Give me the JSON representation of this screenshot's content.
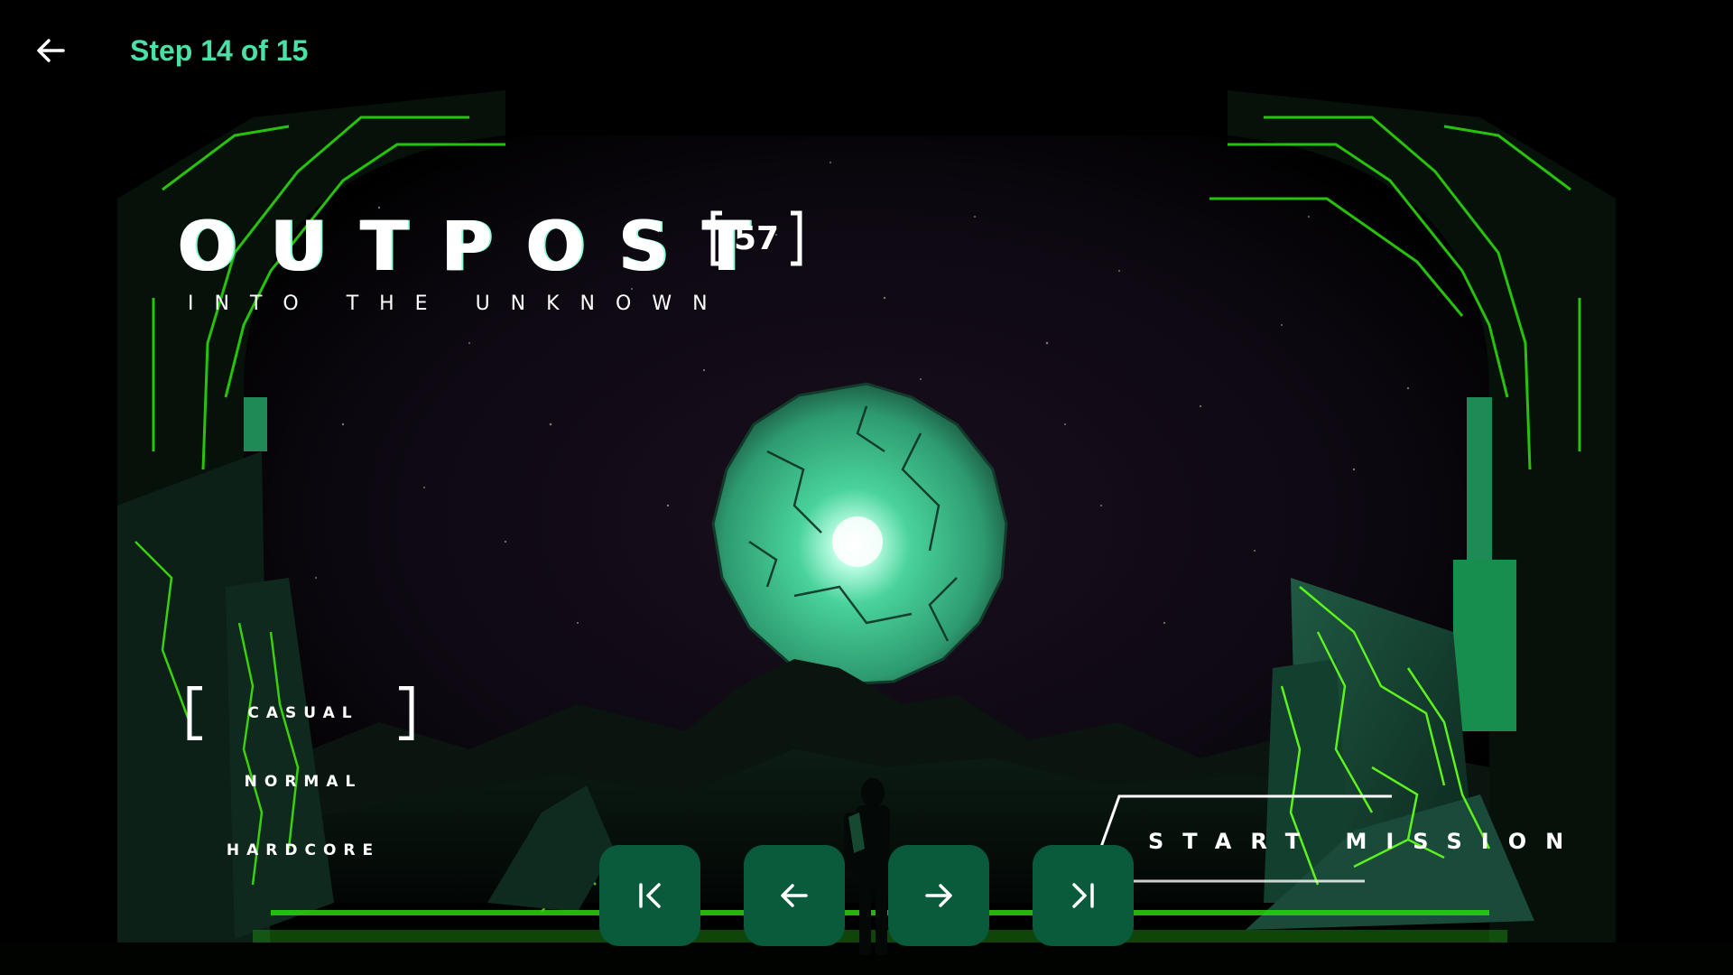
{
  "header": {
    "back_icon": "arrow-left-icon",
    "step_text": "Step 14 of 15"
  },
  "game": {
    "title": "OUTPOST",
    "badge": "57",
    "subtitle": "INTO THE UNKNOWN"
  },
  "difficulty": {
    "options": [
      "CASUAL",
      "NORMAL",
      "HARDCORE"
    ],
    "selected": "CASUAL"
  },
  "start_button": {
    "label": "START MISSION"
  },
  "navigation": {
    "first_icon": "skip-first-icon",
    "prev_icon": "arrow-left-icon",
    "next_icon": "arrow-right-icon",
    "last_icon": "skip-last-icon"
  },
  "colors": {
    "accent": "#4be0a6",
    "neon_green": "#2bd60a",
    "button_fill": "#0a5a3c",
    "orb": "#3fc28e"
  }
}
